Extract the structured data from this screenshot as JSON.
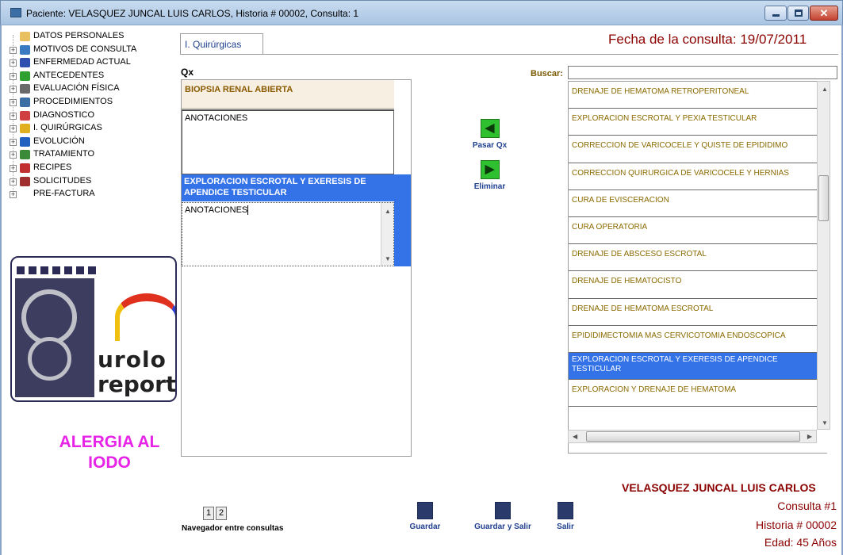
{
  "window": {
    "title": "Paciente: VELASQUEZ JUNCAL LUIS CARLOS, Historia # 00002, Consulta: 1",
    "close_glyph": "✕"
  },
  "tree": {
    "items": [
      {
        "label": "DATOS PERSONALES",
        "icon": "folder-icon",
        "expander": ""
      },
      {
        "label": "MOTIVOS DE CONSULTA",
        "icon": "pointer-icon",
        "expander": "+"
      },
      {
        "label": "ENFERMEDAD ACTUAL",
        "icon": "bars-icon",
        "expander": "+"
      },
      {
        "label": "ANTECEDENTES",
        "icon": "apple-icon",
        "expander": "+"
      },
      {
        "label": "EVALUACIÓN FÍSICA",
        "icon": "scale-icon",
        "expander": "+"
      },
      {
        "label": "PROCEDIMIENTOS",
        "icon": "monitor-icon",
        "expander": "+"
      },
      {
        "label": "DIAGNOSTICO",
        "icon": "arrow-icon",
        "expander": "+"
      },
      {
        "label": "I. QUIRÚRGICAS",
        "icon": "bolt-icon",
        "expander": "+"
      },
      {
        "label": "EVOLUCIÓN",
        "icon": "info-icon",
        "expander": "+"
      },
      {
        "label": "TRATAMIENTO",
        "icon": "person-icon",
        "expander": "+"
      },
      {
        "label": "RECIPES",
        "icon": "bottle-icon",
        "expander": "+"
      },
      {
        "label": "SOLICITUDES",
        "icon": "form-icon",
        "expander": "+"
      },
      {
        "label": "PRE-FACTURA",
        "icon": "",
        "expander": "+"
      }
    ]
  },
  "logo": {
    "line1": "urolo",
    "line2": "report"
  },
  "alert": {
    "line1": "ALERGIA AL",
    "line2": "IODO"
  },
  "tab": {
    "label": "I. Quirúrgicas"
  },
  "fecha": {
    "text": "Fecha de la consulta:  19/07/2011"
  },
  "qx": {
    "label": "Qx",
    "items": [
      {
        "title": "BIOPSIA RENAL ABIERTA",
        "notes": "ANOTACIONES"
      },
      {
        "title": "EXPLORACION ESCROTAL Y EXERESIS DE APENDICE TESTICULAR",
        "notes": "ANOTACIONES"
      }
    ]
  },
  "actions": {
    "pasar": "Pasar Qx",
    "eliminar": "Eliminar"
  },
  "buscar": {
    "label": "Buscar:",
    "value": ""
  },
  "list": {
    "items": [
      {
        "label": "DRENAJE DE HEMATOMA RETROPERITONEAL"
      },
      {
        "label": "EXPLORACION ESCROTAL Y PEXIA TESTICULAR"
      },
      {
        "label": "CORRECCION DE VARICOCELE Y QUISTE DE EPIDIDIMO"
      },
      {
        "label": "CORRECCION QUIRURGICA DE VARICOCELE Y HERNIAS"
      },
      {
        "label": "CURA DE EVISCERACION"
      },
      {
        "label": "CURA OPERATORIA"
      },
      {
        "label": "DRENAJE DE ABSCESO ESCROTAL"
      },
      {
        "label": "DRENAJE DE HEMATOCISTO"
      },
      {
        "label": "DRENAJE DE HEMATOMA ESCROTAL"
      },
      {
        "label": "EPIDIDIMECTOMIA MAS CERVICOTOMIA ENDOSCOPICA"
      },
      {
        "label": "EXPLORACION ESCROTAL Y EXERESIS DE APENDICE TESTICULAR"
      },
      {
        "label": "EXPLORACION Y DRENAJE DE HEMATOMA"
      }
    ],
    "selected_index": 10
  },
  "patient": {
    "name": "VELASQUEZ JUNCAL LUIS CARLOS",
    "consulta": "Consulta #1",
    "historia": "Historia # 00002",
    "edad": "Edad: 45 Años"
  },
  "nav": {
    "btn1": "1",
    "btn2": "2",
    "label": "Navegador entre consultas"
  },
  "toolbar": {
    "guardar": "Guardar",
    "guardar_salir": "Guardar y Salir",
    "salir": "Salir"
  },
  "colors": {
    "accent": "#3472e8",
    "dark_red": "#8b0000",
    "alert": "#e623e6"
  }
}
